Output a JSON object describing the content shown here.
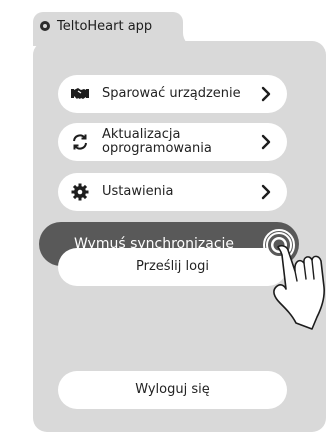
{
  "app": {
    "title": "TeltoHeart app"
  },
  "menu": {
    "pair": {
      "label": "Sparować urządzenie",
      "icon": "handshake-icon"
    },
    "update": {
      "label_line1": "Aktualizacja",
      "label_line2": "oprogramowania",
      "icon": "sync-icon"
    },
    "settings": {
      "label": "Ustawienia",
      "icon": "gear-icon"
    },
    "force_sync": {
      "label": "Wymuś synchronizację"
    },
    "send_logs": {
      "label": "Prześlij logi"
    },
    "logout": {
      "label": "Wyloguj się"
    }
  },
  "colors": {
    "panel": "#d9d9d9",
    "active_button": "#595959",
    "button": "#ffffff"
  }
}
